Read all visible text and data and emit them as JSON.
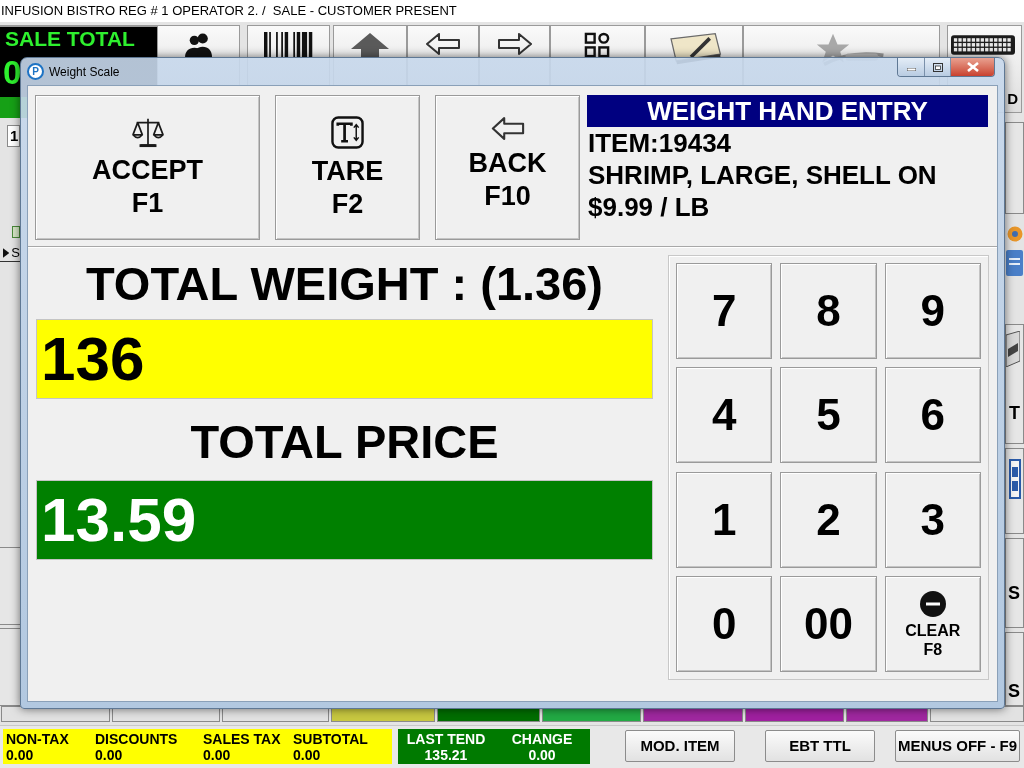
{
  "app": {
    "title": "INFUSION BISTRO REG # 1 OPERATOR 2. /  SALE - CUSTOMER PRESENT"
  },
  "sale_total": {
    "label": "SALE TOTAL",
    "value": "0"
  },
  "keyboard_button": {
    "label": "D"
  },
  "order_panel": {
    "quantity": "1",
    "row_label": "S"
  },
  "side_buttons": [
    {
      "label": "T"
    },
    {
      "label": "S"
    },
    {
      "label": "S"
    }
  ],
  "menu_buttons": [
    {
      "color": "#e2e2e2"
    },
    {
      "color": "#e2e2e2"
    },
    {
      "color": "#e2e2e2"
    },
    {
      "color": "#c8c840"
    },
    {
      "color": "#006e00"
    },
    {
      "color": "#22aa44"
    },
    {
      "color": "#a028a0"
    },
    {
      "color": "#a020a0"
    },
    {
      "color": "#a028a0"
    },
    {
      "color": "#e2e2e2"
    }
  ],
  "dialog": {
    "logo_letter": "P",
    "title": "Weight Scale",
    "actions": [
      {
        "kind": "accept",
        "label": "ACCEPT",
        "key": "F1"
      },
      {
        "kind": "tare",
        "label": "TARE",
        "key": "F2"
      },
      {
        "kind": "back",
        "label": "BACK",
        "key": "F10"
      }
    ],
    "item_info": {
      "heading": "WEIGHT HAND ENTRY",
      "item": "ITEM:19434",
      "description": "SHRIMP, LARGE, SHELL ON",
      "price": "$9.99 / LB"
    },
    "weight": {
      "label": "TOTAL WEIGHT : (1.36)",
      "value": "136"
    },
    "price": {
      "label": "TOTAL PRICE",
      "value": "13.59"
    },
    "keypad": [
      {
        "kind": "digit",
        "label": "7"
      },
      {
        "kind": "digit",
        "label": "8"
      },
      {
        "kind": "digit",
        "label": "9"
      },
      {
        "kind": "digit",
        "label": "4"
      },
      {
        "kind": "digit",
        "label": "5"
      },
      {
        "kind": "digit",
        "label": "6"
      },
      {
        "kind": "digit",
        "label": "1"
      },
      {
        "kind": "digit",
        "label": "2"
      },
      {
        "kind": "digit",
        "label": "3"
      },
      {
        "kind": "digit",
        "label": "0"
      },
      {
        "kind": "digit",
        "label": "00"
      },
      {
        "kind": "clear",
        "label": "CLEAR",
        "key": "F8"
      }
    ]
  },
  "totals": [
    {
      "label": "NON-TAX",
      "value": "0.00"
    },
    {
      "label": "DISCOUNTS",
      "value": "0.00"
    },
    {
      "label": "SALES TAX",
      "value": "0.00"
    },
    {
      "label": "SUBTOTAL",
      "value": "0.00"
    }
  ],
  "tender": [
    {
      "label": "LAST TEND",
      "value": "135.21"
    },
    {
      "label": "CHANGE",
      "value": "0.00"
    }
  ],
  "buttons": [
    "MOD. ITEM",
    "EBT TTL",
    "MENUS OFF - F9"
  ]
}
